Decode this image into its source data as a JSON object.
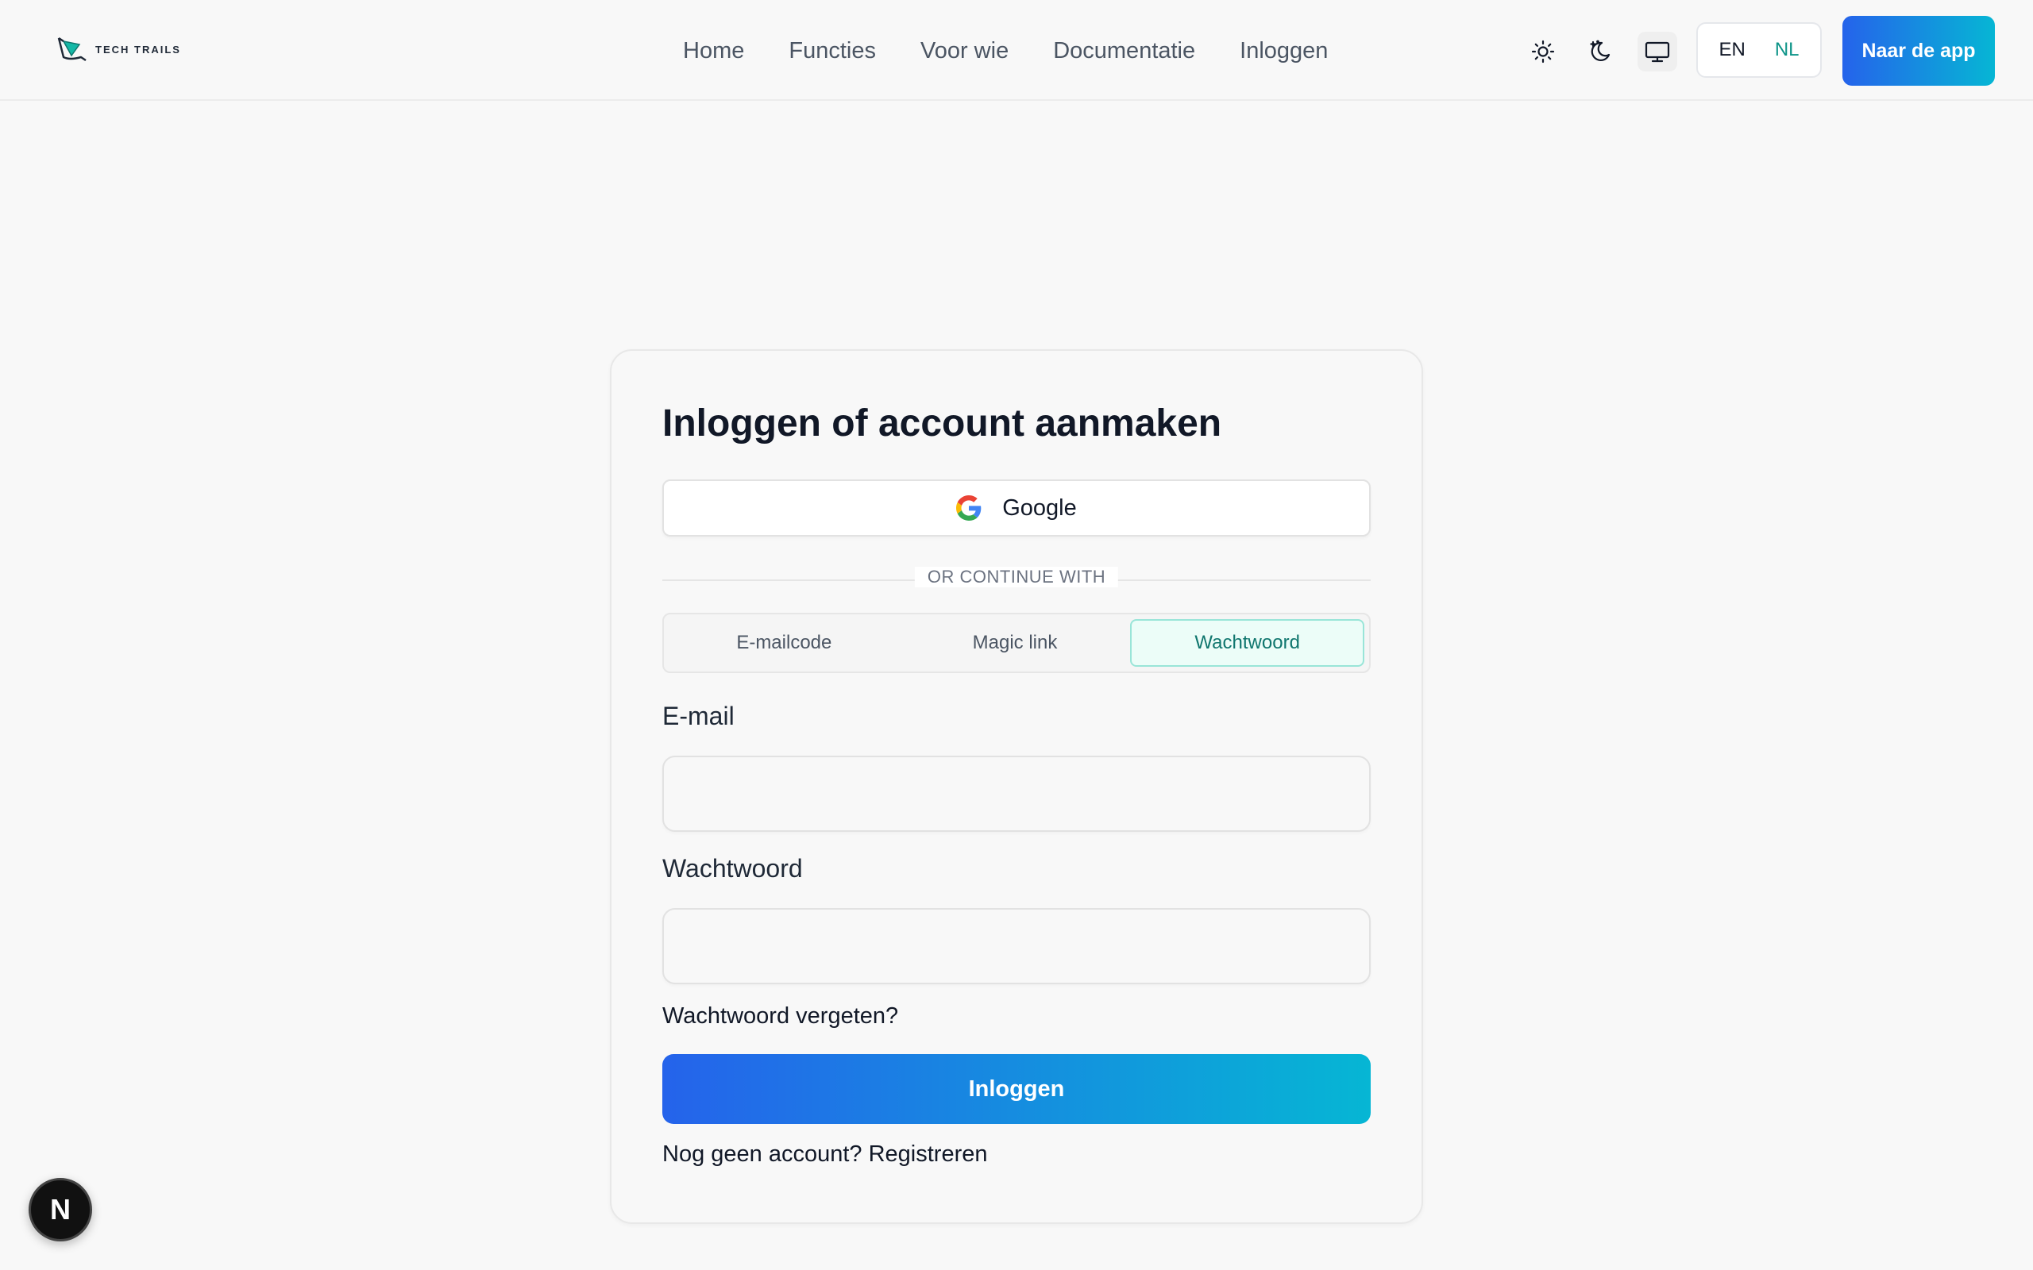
{
  "brand": {
    "name": "TECH TRAILS"
  },
  "nav": {
    "items": [
      {
        "label": "Home"
      },
      {
        "label": "Functies"
      },
      {
        "label": "Voor wie"
      },
      {
        "label": "Documentatie"
      },
      {
        "label": "Inloggen"
      }
    ]
  },
  "theme": {
    "options": [
      "sun-icon",
      "moon-icon",
      "monitor-icon"
    ],
    "selected": "monitor-icon"
  },
  "language": {
    "options": [
      "EN",
      "NL"
    ],
    "selected": "NL"
  },
  "header": {
    "app_button_label": "Naar de app"
  },
  "auth": {
    "title": "Inloggen of account aanmaken",
    "google_label": "Google",
    "divider_text": "OR CONTINUE WITH",
    "tabs": [
      {
        "label": "E-mailcode"
      },
      {
        "label": "Magic link"
      },
      {
        "label": "Wachtwoord"
      }
    ],
    "active_tab": "Wachtwoord",
    "email_label": "E-mail",
    "email_value": "",
    "password_label": "Wachtwoord",
    "password_value": "",
    "forgot_label": "Wachtwoord vergeten?",
    "submit_label": "Inloggen",
    "register_text": "Nog geen account? Registreren"
  },
  "dev_badge": {
    "label": "N"
  },
  "colors": {
    "accent_start": "#2563eb",
    "accent_end": "#06b6d4",
    "active_teal": "#0d9488",
    "background": "#f8f8f8"
  }
}
